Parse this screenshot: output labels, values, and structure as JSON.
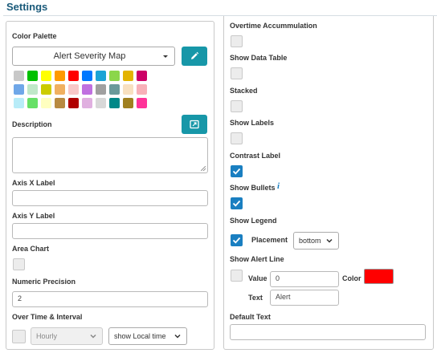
{
  "page": {
    "title": "Settings"
  },
  "left": {
    "color_palette": {
      "label": "Color Palette",
      "selected": "Alert Severity Map",
      "swatches": [
        [
          "#c8c8c8",
          "#00c000",
          "#ffff00",
          "#ff9a00",
          "#ff0000",
          "#0078ff",
          "#1aa3d6",
          "#8bd64a",
          "#e3b300",
          "#cc0066"
        ],
        [
          "#6fa7e8",
          "#bfe8c8",
          "#cccc00",
          "#f0b060",
          "#f8c8c8",
          "#c070e0",
          "#a0a0a0",
          "#6a9a9a",
          "#f8e0c0",
          "#f8b0b8"
        ],
        [
          "#b8ecf8",
          "#66e066",
          "#ffffc0",
          "#b88a40",
          "#b00000",
          "#e0b0e0",
          "#d8d8d8",
          "#008888",
          "#a08020",
          "#ff3399"
        ]
      ]
    },
    "description": {
      "label": "Description",
      "value": ""
    },
    "axis_x": {
      "label": "Axis X Label",
      "value": ""
    },
    "axis_y": {
      "label": "Axis Y Label",
      "value": ""
    },
    "area_chart": {
      "label": "Area Chart",
      "checked": false
    },
    "numeric_precision": {
      "label": "Numeric Precision",
      "value": "2"
    },
    "over_time": {
      "label": "Over Time & Interval",
      "checked": false,
      "interval": "Hourly",
      "time": "show Local time"
    }
  },
  "right": {
    "overtime_accumulation": {
      "label": "Overtime Accummulation",
      "checked": false
    },
    "show_data_table": {
      "label": "Show Data Table",
      "checked": false
    },
    "stacked": {
      "label": "Stacked",
      "checked": false
    },
    "show_labels": {
      "label": "Show Labels",
      "checked": false
    },
    "contrast_label": {
      "label": "Contrast Label",
      "checked": true
    },
    "show_bullets": {
      "label": "Show Bullets",
      "checked": true,
      "info_glyph": "i"
    },
    "show_legend": {
      "label": "Show Legend",
      "checked": true,
      "placement_label": "Placement",
      "placement": "bottom"
    },
    "show_alert_line": {
      "label": "Show Alert Line",
      "checked": false,
      "value_label": "Value",
      "value": "0",
      "color_label": "Color",
      "color": "#ff0000",
      "text_label": "Text",
      "text": "Alert"
    },
    "default_text": {
      "label": "Default Text",
      "value": ""
    }
  },
  "colors": {
    "accent": "#1797a8",
    "checkbox": "#1a7fc1",
    "heading": "#1a5a7a"
  }
}
